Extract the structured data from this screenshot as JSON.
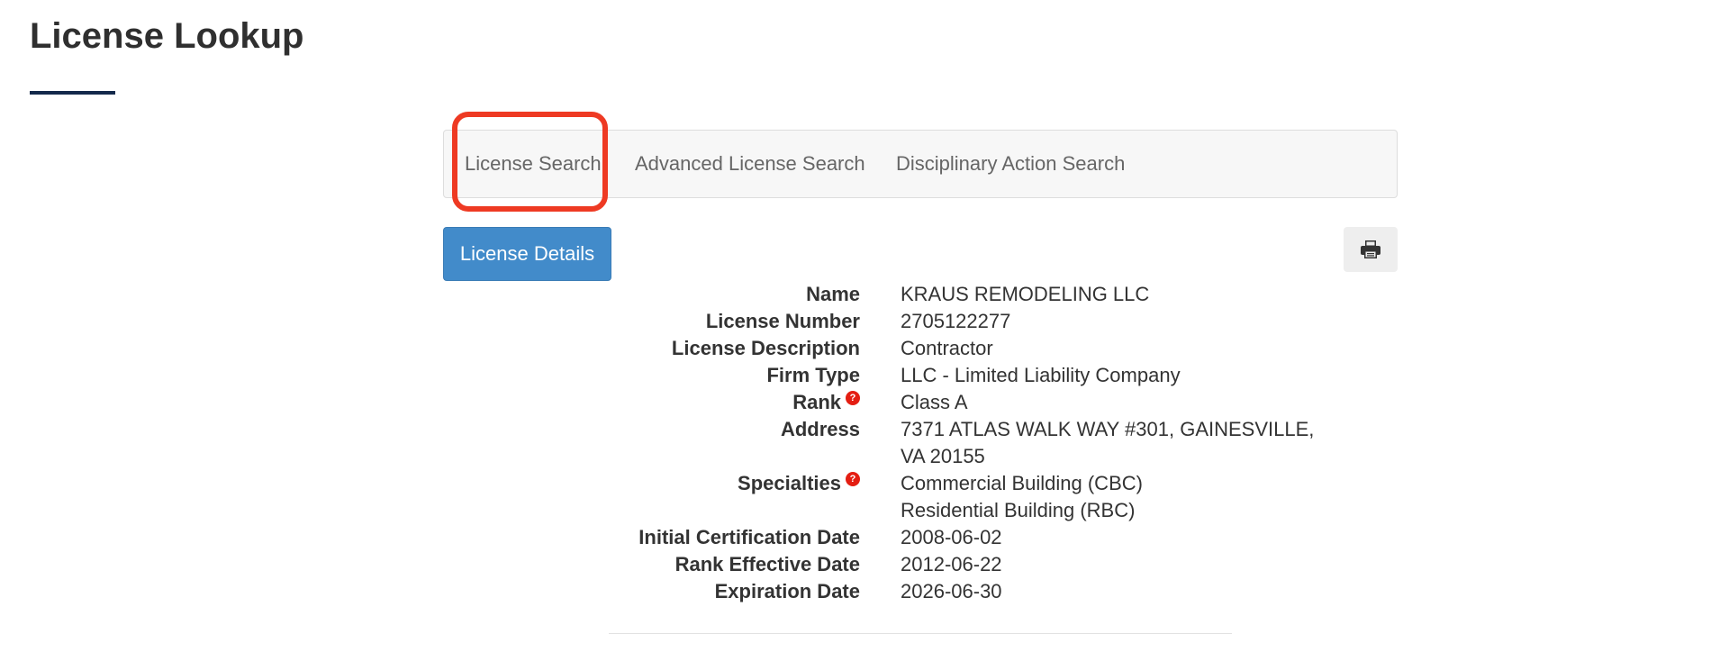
{
  "page": {
    "title": "License Lookup"
  },
  "tabs": [
    {
      "label": "License Search"
    },
    {
      "label": "Advanced License Search"
    },
    {
      "label": "Disciplinary Action Search"
    }
  ],
  "toolbar": {
    "details_label": "License Details",
    "print_icon": "printer-icon"
  },
  "details": {
    "name": {
      "label": "Name",
      "value": "KRAUS REMODELING LLC"
    },
    "license_number": {
      "label": "License Number",
      "value": "2705122277"
    },
    "license_description": {
      "label": "License Description",
      "value": "Contractor"
    },
    "firm_type": {
      "label": "Firm Type",
      "value": "LLC - Limited Liability Company"
    },
    "rank": {
      "label": "Rank",
      "value": "Class A",
      "help": "?"
    },
    "address": {
      "label": "Address",
      "value": "7371 ATLAS WALK WAY #301, GAINESVILLE, VA 20155"
    },
    "specialties": {
      "label": "Specialties",
      "help": "?",
      "values": [
        "Commercial Building (CBC)",
        "Residential Building (RBC)"
      ]
    },
    "initial_certification_date": {
      "label": "Initial Certification Date",
      "value": "2008-06-02"
    },
    "rank_effective_date": {
      "label": "Rank Effective Date",
      "value": "2012-06-22"
    },
    "expiration_date": {
      "label": "Expiration Date",
      "value": "2026-06-30"
    }
  },
  "colors": {
    "highlight": "#ee3a23",
    "button_primary": "#428bca",
    "help_icon": "#e41e12",
    "title_underline": "#13294b"
  }
}
